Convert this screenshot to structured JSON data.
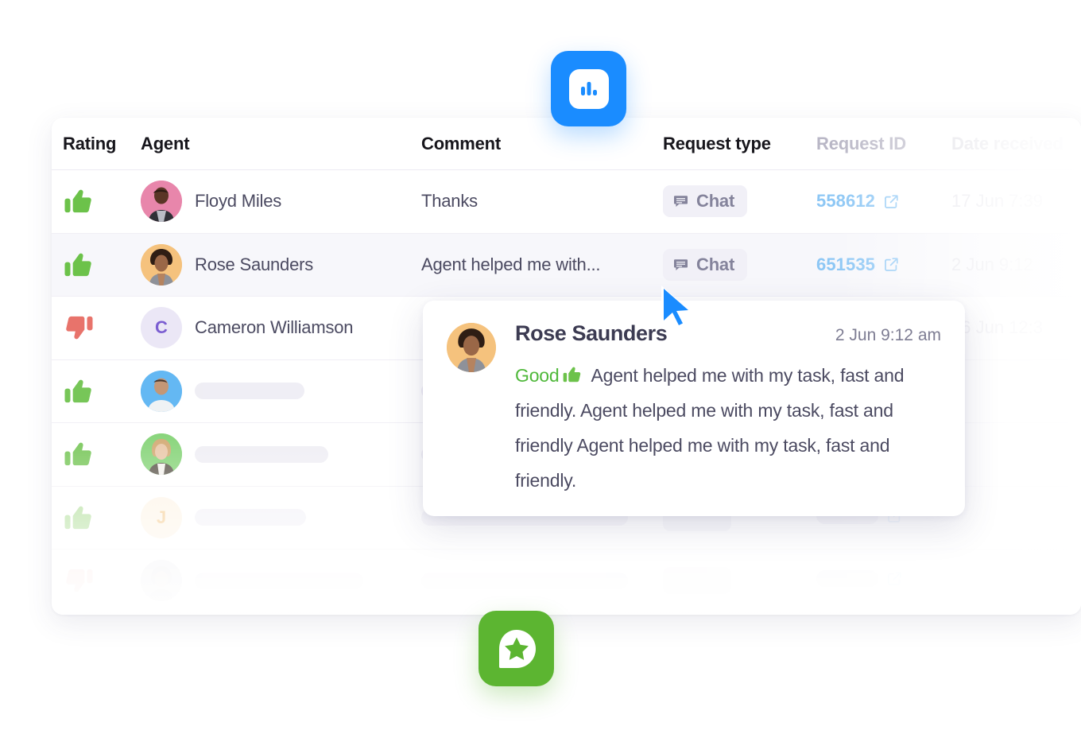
{
  "table": {
    "columns": [
      {
        "key": "rating",
        "label": "Rating",
        "style": "strong"
      },
      {
        "key": "agent",
        "label": "Agent",
        "style": "strong"
      },
      {
        "key": "comment",
        "label": "Comment",
        "style": "strong"
      },
      {
        "key": "type",
        "label": "Request type",
        "style": "strong"
      },
      {
        "key": "id",
        "label": "Request ID",
        "style": "dim"
      },
      {
        "key": "date",
        "label": "Date received",
        "style": "dim2"
      }
    ],
    "rows": [
      {
        "rating": "thumbs-up",
        "agent_name": "Floyd Miles",
        "avatar_kind": "photo",
        "avatar_bg": "#e886ab",
        "comment": "Thanks",
        "request_type": "Chat",
        "request_id": "558612",
        "date": "17 Jun 7:39",
        "highlighted": false,
        "placeholder": false
      },
      {
        "rating": "thumbs-up",
        "agent_name": "Rose Saunders",
        "avatar_kind": "photo",
        "avatar_bg": "#f5c27d",
        "comment": "Agent helped me with...",
        "request_type": "Chat",
        "request_id": "651535",
        "date": "2 Jun 9:12",
        "highlighted": true,
        "placeholder": false
      },
      {
        "rating": "thumbs-down",
        "agent_name": "Cameron Williamson",
        "avatar_kind": "initial",
        "avatar_initial": "C",
        "avatar_bg": "#ebe7f6",
        "avatar_fg": "#7b5ed1",
        "comment": "",
        "request_type": "",
        "request_id": "",
        "date": "26 Jun 12:3",
        "highlighted": false,
        "placeholder": false
      },
      {
        "rating": "thumbs-up",
        "agent_name": "",
        "avatar_kind": "photo",
        "avatar_bg": "#57b2f2",
        "comment": "",
        "request_type": "",
        "request_id": "",
        "date": "",
        "highlighted": false,
        "placeholder": true
      },
      {
        "rating": "thumbs-up",
        "agent_name": "",
        "avatar_kind": "photo",
        "avatar_bg": "#7ad06b",
        "comment": "",
        "request_type": "",
        "request_id": "",
        "date": "",
        "highlighted": false,
        "placeholder": true
      },
      {
        "rating": "thumbs-up",
        "agent_name": "",
        "avatar_kind": "initial",
        "avatar_initial": "J",
        "avatar_bg": "#fdf0dd",
        "avatar_fg": "#f0b35c",
        "comment": "",
        "request_type": "",
        "request_id": "",
        "date": "",
        "highlighted": false,
        "placeholder": true
      },
      {
        "rating": "thumbs-down",
        "agent_name": "",
        "avatar_kind": "photo",
        "avatar_bg": "#dcdce4",
        "comment": "",
        "request_type": "",
        "request_id": "",
        "date": "",
        "highlighted": false,
        "placeholder": true
      }
    ]
  },
  "popup": {
    "agent_name": "Rose Saunders",
    "timestamp": "2 Jun 9:12 am",
    "rating_label": "Good",
    "rating_icon": "thumbs-up-icon",
    "comment": "Agent helped me with my task, fast and friendly. Agent helped me with my task, fast and friendly Agent helped me with my task, fast and friendly.",
    "avatar_bg": "#f5c27d"
  },
  "floating_icons": [
    {
      "name": "analytics-app-icon",
      "glyph": "bar-chart-icon",
      "color": "#1a8cff"
    },
    {
      "name": "feedback-app-icon",
      "glyph": "star-message-icon",
      "color": "#5cb531"
    }
  ],
  "cursor": {
    "name": "mouse-pointer",
    "color": "#1a8cff"
  },
  "colors": {
    "thumbs_up": "#6cc24a",
    "thumbs_down": "#e8736b",
    "link": "#8dc7f5",
    "badge_bg": "#f1f0f7",
    "badge_text": "#84839b",
    "good_text": "#4fb83a",
    "row_highlight": "#f7f7fb"
  }
}
